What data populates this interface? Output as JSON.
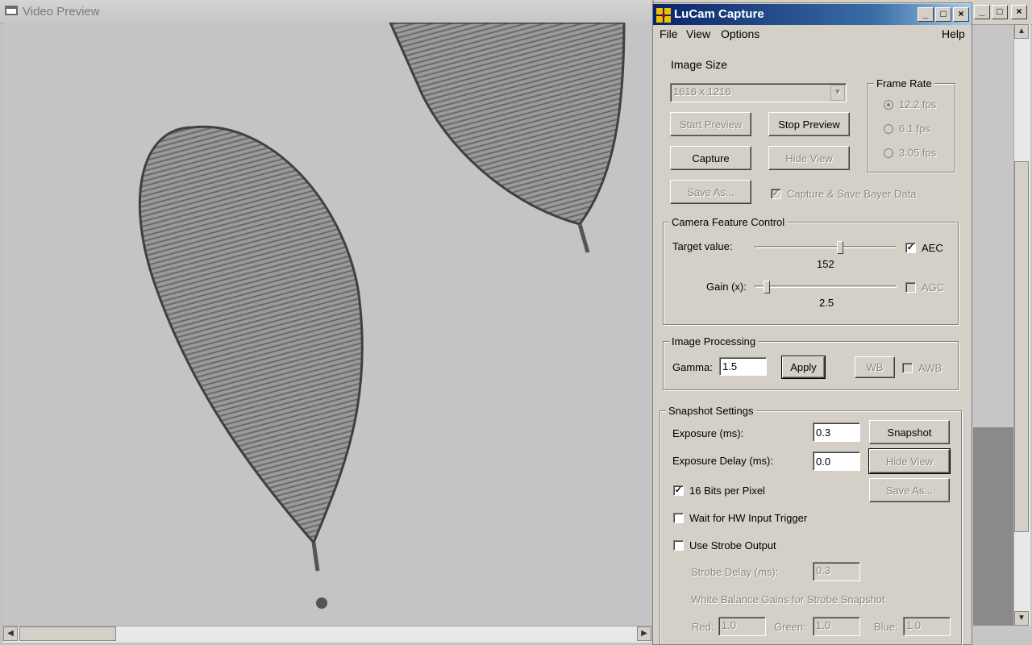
{
  "video_preview": {
    "title": "Video Preview"
  },
  "lucam": {
    "title": "LuCam Capture",
    "menu": {
      "file": "File",
      "view": "View",
      "options": "Options",
      "help": "Help"
    },
    "image_size": {
      "label": "Image Size",
      "value": "1616 x 1216"
    },
    "frame_rate": {
      "label": "Frame Rate",
      "options": [
        "12.2 fps",
        "6.1 fps",
        "3.05 fps"
      ],
      "selected": "12.2 fps"
    },
    "buttons": {
      "start_preview": "Start Preview",
      "stop_preview": "Stop Preview",
      "capture": "Capture",
      "hide_view": "Hide View",
      "save_as": "Save As..."
    },
    "capture_bayer": "Capture & Save Bayer Data",
    "camera_feature": {
      "label": "Camera Feature Control",
      "target_label": "Target value:",
      "target_value": "152",
      "aec": "AEC",
      "gain_label": "Gain (x):",
      "gain_value": "2.5",
      "agc": "AGC"
    },
    "image_processing": {
      "label": "Image Processing",
      "gamma_label": "Gamma:",
      "gamma_value": "1.5",
      "apply": "Apply",
      "wb": "WB",
      "awb": "AWB"
    },
    "snapshot": {
      "label": "Snapshot Settings",
      "exposure_label": "Exposure (ms):",
      "exposure_value": "0.3",
      "delay_label": "Exposure Delay (ms):",
      "delay_value": "0.0",
      "snapshot_btn": "Snapshot",
      "hide_view": "Hide View",
      "save_as": "Save As...",
      "bits16": "16 Bits per Pixel",
      "hw_trigger": "Wait for HW Input Trigger",
      "strobe": "Use Strobe Output",
      "strobe_delay_label": "Strobe Delay (ms):",
      "strobe_delay_value": "0.3",
      "wb_gains_label": "White Balance Gains for Strobe Snapshot",
      "red_label": "Red:",
      "red_value": "1.0",
      "green_label": "Green:",
      "green_value": "1.0",
      "blue_label": "Blue:",
      "blue_value": "1.0"
    }
  }
}
